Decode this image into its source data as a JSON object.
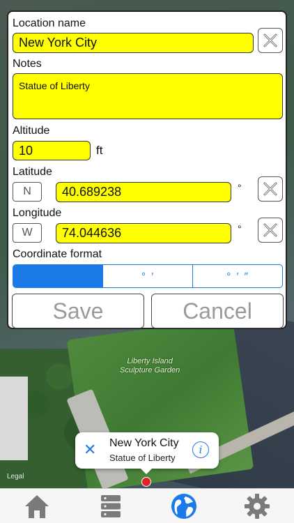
{
  "form": {
    "location_name_label": "Location name",
    "location_name_value": "New York City",
    "notes_label": "Notes",
    "notes_value": "Statue of Liberty",
    "altitude_label": "Altitude",
    "altitude_value": "10",
    "altitude_unit": "ft",
    "latitude_label": "Latitude",
    "latitude_hemisphere": "N",
    "latitude_value": "40.689238",
    "longitude_label": "Longitude",
    "longitude_hemisphere": "W",
    "longitude_value": "74.044636",
    "degree_symbol": "°",
    "coordinate_format_label": "Coordinate format",
    "coordinate_formats": [
      "",
      "° ′",
      "° ′ ″"
    ],
    "selected_format_index": 0,
    "save_label": "Save",
    "cancel_label": "Cancel"
  },
  "map": {
    "place_label_line1": "Liberty Island",
    "place_label_line2": "Sculpture Garden",
    "legal_label": "Legal"
  },
  "callout": {
    "title": "New York City",
    "subtitle": "Statue of Liberty",
    "close_glyph": "✕",
    "info_glyph": "i"
  },
  "tabbar": {
    "items": [
      "home-icon",
      "list-icon",
      "globe-icon",
      "gear-icon"
    ],
    "active_index": 2
  },
  "colors": {
    "field_yellow": "#ffff00",
    "accent_blue": "#1a7ae8",
    "pin_red": "#e0202a"
  }
}
